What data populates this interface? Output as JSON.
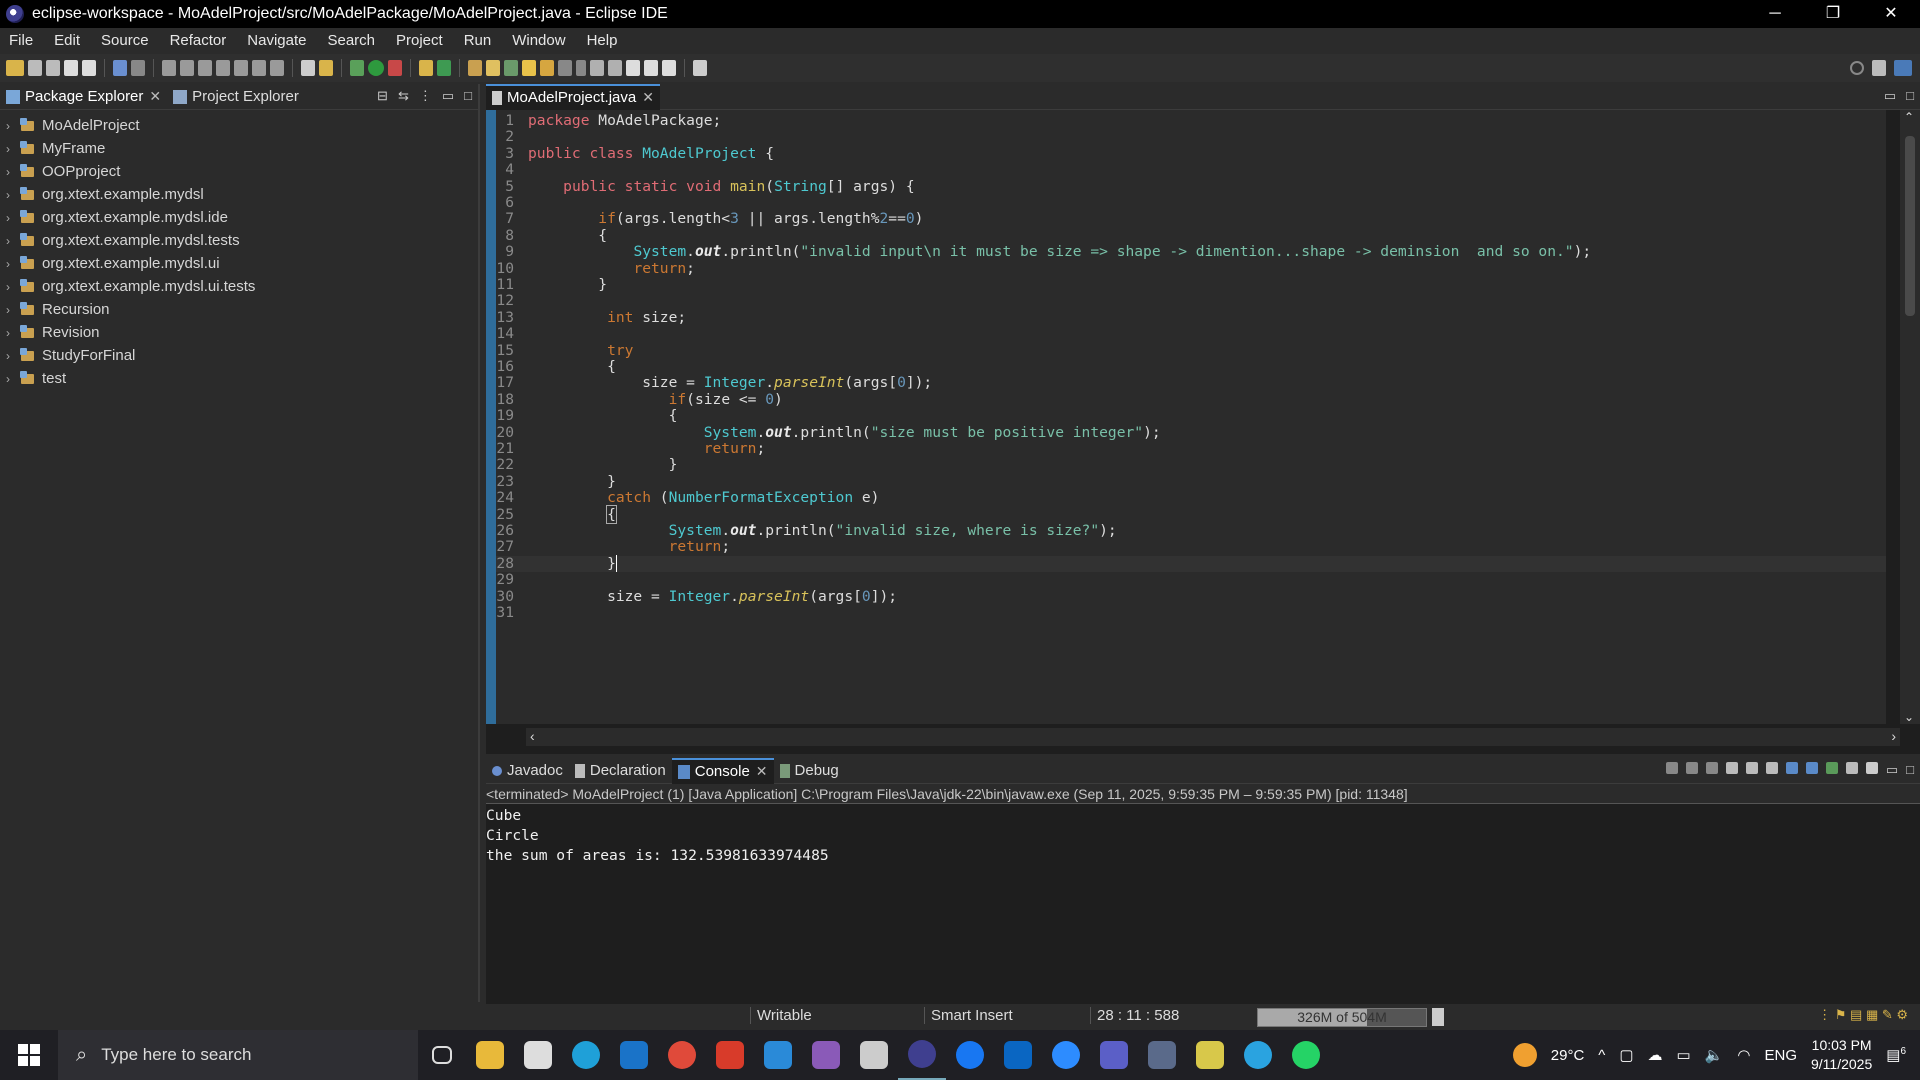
{
  "window": {
    "title": "eclipse-workspace - MoAdelProject/src/MoAdelPackage/MoAdelProject.java - Eclipse IDE",
    "controls": {
      "minimize": "─",
      "restore": "❐",
      "close": "✕"
    }
  },
  "menu": [
    "File",
    "Edit",
    "Source",
    "Refactor",
    "Navigate",
    "Search",
    "Project",
    "Run",
    "Window",
    "Help"
  ],
  "left_panel": {
    "tabs": [
      {
        "label": "Package Explorer",
        "close": "✕"
      },
      {
        "label": "Project Explorer"
      }
    ],
    "projects": [
      "MoAdelProject",
      "MyFrame",
      "OOPproject",
      "org.xtext.example.mydsl",
      "org.xtext.example.mydsl.ide",
      "org.xtext.example.mydsl.tests",
      "org.xtext.example.mydsl.ui",
      "org.xtext.example.mydsl.ui.tests",
      "Recursion",
      "Revision",
      "StudyForFinal",
      "test"
    ]
  },
  "editor": {
    "tab": {
      "label": "MoAdelProject.java",
      "close": "✕"
    },
    "current_line": 28,
    "lines": [
      "1",
      "2",
      "3",
      "4",
      "5",
      "6",
      "7",
      "8",
      "9",
      "10",
      "11",
      "12",
      "13",
      "14",
      "15",
      "16",
      "17",
      "18",
      "19",
      "20",
      "21",
      "22",
      "23",
      "24",
      "25",
      "26",
      "27",
      "28",
      "29",
      "30",
      "31"
    ]
  },
  "bottom_panel": {
    "tabs": [
      {
        "label": "Javadoc"
      },
      {
        "label": "Declaration"
      },
      {
        "label": "Console",
        "close": "✕"
      },
      {
        "label": "Debug"
      }
    ],
    "status": "<terminated> MoAdelProject (1) [Java Application] C:\\Program Files\\Java\\jdk-22\\bin\\javaw.exe  (Sep 11, 2025, 9:59:35 PM – 9:59:35 PM) [pid: 11348]",
    "output": [
      "Cube",
      "Circle",
      "the sum of areas is: 132.53981633974485"
    ]
  },
  "statusbar": {
    "writable": "Writable",
    "insert_mode": "Smart Insert",
    "position": "28 : 11 : 588",
    "heap": "326M of 504M",
    "heap_used_fraction": 0.647
  },
  "taskbar": {
    "search_placeholder": "Type here to search",
    "temperature": "29°C",
    "language": "ENG",
    "time": "10:03 PM",
    "date": "9/11/2025",
    "notifications": "6"
  }
}
